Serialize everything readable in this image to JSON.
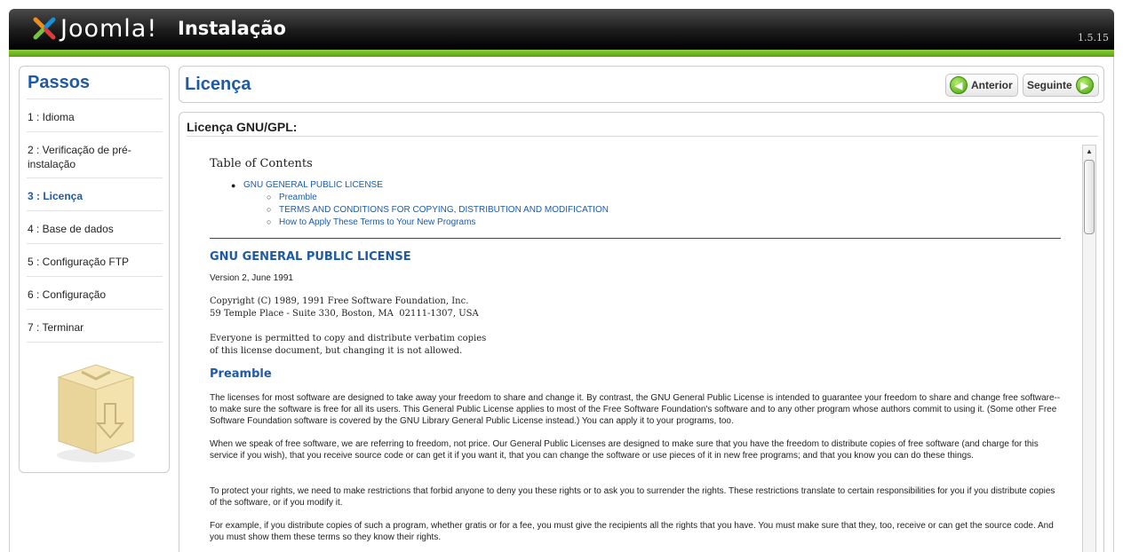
{
  "header": {
    "logo_text": "Joomla!",
    "title": "Instalação",
    "version": "1.5.15"
  },
  "steps": {
    "title": "Passos",
    "items": [
      {
        "label": "1 : Idioma"
      },
      {
        "label": "2 : Verificação de pré-instalação"
      },
      {
        "label": "3 : Licença",
        "active": true
      },
      {
        "label": "4 : Base de dados"
      },
      {
        "label": "5 : Configuração FTP"
      },
      {
        "label": "6 : Configuração"
      },
      {
        "label": "7 : Terminar"
      }
    ]
  },
  "page": {
    "title": "Licença",
    "prev_label": "Anterior",
    "next_label": "Seguinte"
  },
  "license": {
    "heading": "Licença GNU/GPL:",
    "toc_title": "Table of Contents",
    "toc": [
      "GNU GENERAL PUBLIC LICENSE",
      "Preamble",
      "TERMS AND CONDITIONS FOR COPYING, DISTRIBUTION AND MODIFICATION",
      "How to Apply These Terms to Your New Programs"
    ],
    "gpl_heading": "GNU GENERAL PUBLIC LICENSE",
    "version_line": "Version 2, June 1991",
    "copyright": "Copyright (C) 1989, 1991 Free Software Foundation, Inc.\n59 Temple Place - Suite 330, Boston, MA  02111-1307, USA",
    "permission": "Everyone is permitted to copy and distribute verbatim copies\nof this license document, but changing it is not allowed.",
    "preamble_heading": "Preamble",
    "paragraphs": [
      "The licenses for most software are designed to take away your freedom to share and change it. By contrast, the GNU General Public License is intended to guarantee your freedom to share and change free software--to make sure the software is free for all its users. This General Public License applies to most of the Free Software Foundation's software and to any other program whose authors commit to using it. (Some other Free Software Foundation software is covered by the GNU Library General Public License instead.) You can apply it to your programs, too.",
      "When we speak of free software, we are referring to freedom, not price. Our General Public Licenses are designed to make sure that you have the freedom to distribute copies of free software (and charge for this service if you wish), that you receive source code or can get it if you want it, that you can change the software or use pieces of it in new free programs; and that you know you can do these things.",
      "To protect your rights, we need to make restrictions that forbid anyone to deny you these rights or to ask you to surrender the rights. These restrictions translate to certain responsibilities for you if you distribute copies of the software, or if you modify it.",
      "For example, if you distribute copies of such a program, whether gratis or for a fee, you must give the recipients all the rights that you have. You must make sure that they, too, receive or can get the source code. And you must show them these terms so they know their rights."
    ]
  },
  "colors": {
    "accent_blue": "#1e5aa6",
    "header_green": "#6cb523"
  },
  "icons": {
    "prev": "arrow-left-icon",
    "next": "arrow-right-icon",
    "logo": "joomla-logo-icon",
    "box": "install-box-icon"
  }
}
